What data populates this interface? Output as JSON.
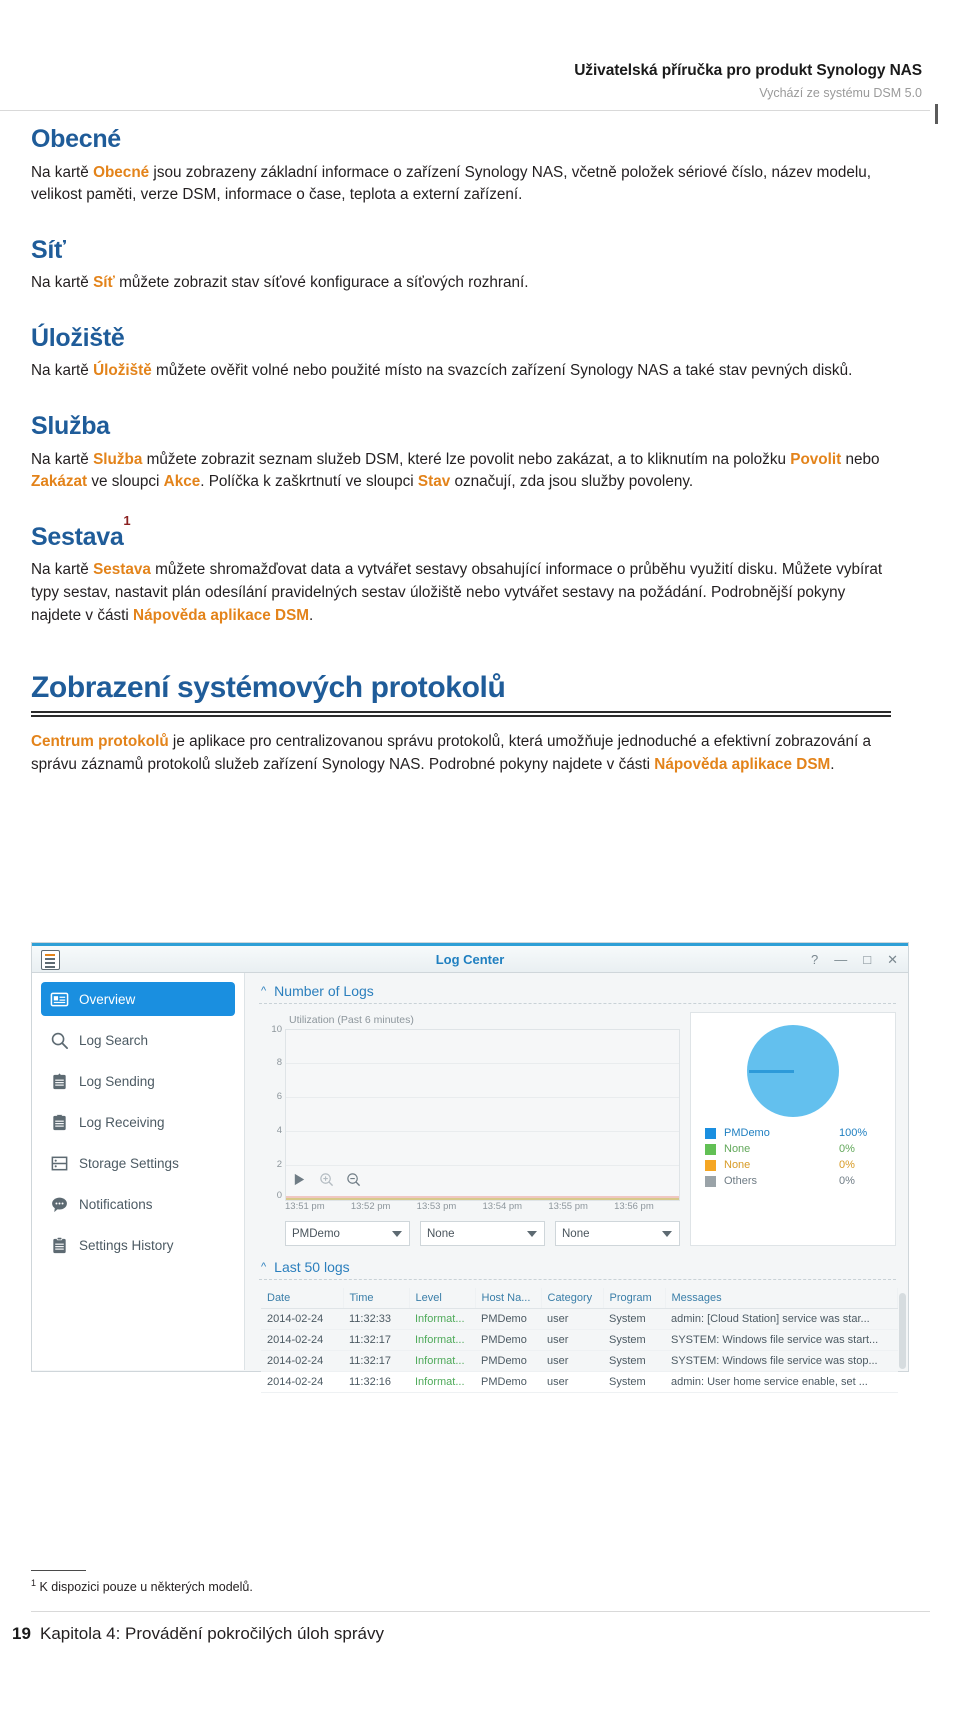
{
  "header": {
    "title": "Uživatelská příručka pro produkt Synology NAS",
    "subtitle": "Vychází ze systému DSM 5.0"
  },
  "sections": [
    {
      "heading": "Obecné",
      "para_1": "Na kartě ",
      "hl_1": "Obecné",
      "para_2": " jsou zobrazeny základní informace o zařízení Synology NAS, včetně položek sériové číslo, název modelu, velikost paměti, verze DSM, informace o čase, teplota a externí zařízení."
    },
    {
      "heading": "Síť",
      "para_1": "Na kartě ",
      "hl_1": "Síť",
      "para_2": " můžete zobrazit stav síťové konfigurace a síťových rozhraní."
    },
    {
      "heading": "Úložiště",
      "para_1": "Na kartě ",
      "hl_1": "Úložiště",
      "para_2": " můžete ověřit volné nebo použité místo na svazcích zařízení Synology NAS a také stav pevných disků."
    },
    {
      "heading": "Služba",
      "para_1": "Na kartě ",
      "hl_1": "Služba",
      "para_2": " můžete zobrazit seznam služeb DSM, které lze povolit nebo zakázat, a to kliknutím na položku ",
      "hl_2": "Povolit",
      "para_3": " nebo ",
      "hl_3": "Zakázat",
      "para_4": " ve sloupci ",
      "hl_4": "Akce",
      "para_5": ". Políčka k zaškrtnutí ve sloupci ",
      "hl_5": "Stav",
      "para_6": " označují, zda jsou služby povoleny."
    },
    {
      "heading": "Sestava",
      "footnote_marker": "1",
      "para_1": "Na kartě ",
      "hl_1": "Sestava",
      "para_2": " můžete shromažďovat data a vytvářet sestavy obsahující informace o průběhu využití disku. Můžete vybírat typy sestav, nastavit plán odesílání pravidelných sestav úložiště nebo vytvářet sestavy na požádání. Podrobnější pokyny najdete v části ",
      "hl_2": "Nápověda aplikace DSM",
      "para_3": "."
    }
  ],
  "chapter": {
    "title": "Zobrazení systémových protokolů",
    "hl_1": "Centrum protokolů",
    "para_1": " je aplikace pro centralizovanou správu protokolů, která umožňuje jednoduché a efektivní zobrazování a správu záznamů protokolů služeb zařízení Synology NAS. Podrobné pokyny najdete v části ",
    "hl_2": "Nápověda aplikace DSM",
    "para_2": "."
  },
  "screenshot": {
    "window_title": "Log Center",
    "window_buttons": [
      "?",
      "—",
      "□",
      "✕"
    ],
    "sidebar": [
      {
        "label": "Overview",
        "icon": "overview-icon",
        "active": true
      },
      {
        "label": "Log Search",
        "icon": "search-icon",
        "active": false
      },
      {
        "label": "Log Sending",
        "icon": "log-sending-icon",
        "active": false
      },
      {
        "label": "Log Receiving",
        "icon": "log-receiving-icon",
        "active": false
      },
      {
        "label": "Storage Settings",
        "icon": "storage-settings-icon",
        "active": false
      },
      {
        "label": "Notifications",
        "icon": "notifications-icon",
        "active": false
      },
      {
        "label": "Settings History",
        "icon": "settings-history-icon",
        "active": false
      }
    ],
    "number_of_logs_title": "Number of Logs",
    "last_logs_title": "Last 50 logs",
    "chart_caption": "Utilization (Past 6 minutes)",
    "dropdowns": [
      "PMDemo",
      "None",
      "None"
    ],
    "table": {
      "columns": [
        "Date",
        "Time",
        "Level",
        "Host Na...",
        "Category",
        "Program",
        "Messages"
      ],
      "rows": [
        [
          "2014-02-24",
          "11:32:33",
          "Informat...",
          "PMDemo",
          "user",
          "System",
          "admin: [Cloud Station] service was star..."
        ],
        [
          "2014-02-24",
          "11:32:17",
          "Informat...",
          "PMDemo",
          "user",
          "System",
          "SYSTEM: Windows file service was start..."
        ],
        [
          "2014-02-24",
          "11:32:17",
          "Informat...",
          "PMDemo",
          "user",
          "System",
          "SYSTEM: Windows file service was stop..."
        ],
        [
          "2014-02-24",
          "11:32:16",
          "Informat...",
          "PMDemo",
          "user",
          "System",
          "admin: User home service enable, set ..."
        ]
      ]
    }
  },
  "chart_data": [
    {
      "type": "line",
      "title": "Utilization (Past 6 minutes)",
      "xlabel": "",
      "ylabel": "",
      "ylim": [
        0,
        10
      ],
      "yticks": [
        10,
        8,
        6,
        4,
        2,
        0
      ],
      "x": [
        "13:51 pm",
        "13:52 pm",
        "13:53 pm",
        "13:54 pm",
        "13:55 pm",
        "13:56 pm"
      ],
      "series": [
        {
          "name": "PMDemo",
          "values": [
            0,
            0,
            0,
            0,
            0,
            0
          ]
        }
      ],
      "grid": true,
      "legend": "none"
    },
    {
      "type": "pie",
      "title": "",
      "labels": [
        "PMDemo",
        "None",
        "None",
        "Others"
      ],
      "values": [
        100,
        0,
        0,
        0
      ],
      "display_values": [
        "100%",
        "0%",
        "0%",
        "0%"
      ],
      "colors": [
        "#1a8fe0",
        "#62c055",
        "#f5a623",
        "#9aa3a8"
      ],
      "slice_color": "#63c0ee",
      "legend": "bottom"
    }
  ],
  "footnote": {
    "marker": "1",
    "text": " K dispozici pouze u některých modelů."
  },
  "footer": {
    "page": "19",
    "text": "Kapitola 4: Provádění pokročilých úloh správy"
  }
}
